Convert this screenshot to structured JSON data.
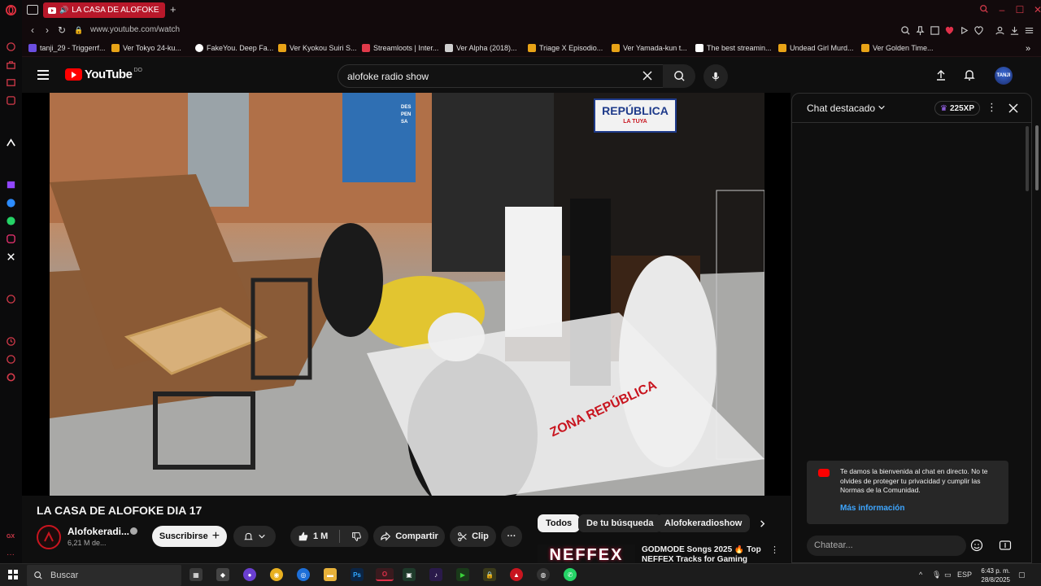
{
  "browser": {
    "active_tab": {
      "title": "LA CASA DE ALOFOKE"
    },
    "address": "www.youtube.com/watch",
    "bookmarks": [
      {
        "label": "tanji_29 - Triggerrf...",
        "color": "#6b4ee0"
      },
      {
        "label": "Ver Tokyo 24-ku...",
        "color": "#e8a317"
      },
      {
        "label": "FakeYou. Deep Fa...",
        "color": "#ffffff"
      },
      {
        "label": "Ver Kyokou Suiri S...",
        "color": "#e8a317"
      },
      {
        "label": "Streamloots | Inter...",
        "color": "#e03a4a"
      },
      {
        "label": "Ver Alpha (2018)...",
        "color": "#cfcfcf"
      },
      {
        "label": "Triage X Episodio...",
        "color": "#e8a317"
      },
      {
        "label": "Ver Yamada-kun t...",
        "color": "#e8a317"
      },
      {
        "label": "The best streamin...",
        "color": "#ffffff"
      },
      {
        "label": "Undead Girl Murd...",
        "color": "#e8a317"
      },
      {
        "label": "Ver Golden Time...",
        "color": "#e8a317"
      }
    ]
  },
  "youtube": {
    "logo_text": "YouTube",
    "logo_country": "DO",
    "search": {
      "value": "alofoke radio show"
    },
    "avatar_text": "TANJI"
  },
  "video": {
    "title": "LA CASA DE ALOFOKE DIA 17",
    "scene_sign": "REPÚBLICA",
    "scene_sign_sub": "LA TUYA",
    "scene_floor": "ZONA REPÚBLICA",
    "scene_shelf": "DES PEN SA"
  },
  "channel": {
    "name": "Alofokeradi...",
    "subscribers": "6,21 M de...",
    "subscribe_label": "Suscribirse"
  },
  "actions": {
    "likes": "1 M",
    "share_label": "Compartir",
    "clip_label": "Clip"
  },
  "chips": [
    {
      "label": "Todos",
      "active": true
    },
    {
      "label": "De tu búsqueda",
      "active": false
    },
    {
      "label": "Alofokeradioshow",
      "active": false
    }
  ],
  "recommendation": {
    "thumb_text": "NEFFEX",
    "title": "GODMODE Songs 2025 🔥 Top NEFFEX Tracks for Gaming"
  },
  "chat": {
    "title": "Chat destacado",
    "xp": "225XP",
    "welcome_text": "Te damos la bienvenida al chat en directo. No te olvides de proteger tu privacidad y cumplir las Normas de la Comunidad.",
    "welcome_link": "Más información",
    "input_placeholder": "Chatear..."
  },
  "taskbar": {
    "search_placeholder": "Buscar",
    "lang": "ESP",
    "time": "6:43 p. m.",
    "date": "28/8/2025"
  },
  "colors": {
    "accent": "#ff0000",
    "opera_red": "#d33a4a",
    "link": "#3ea6ff"
  }
}
